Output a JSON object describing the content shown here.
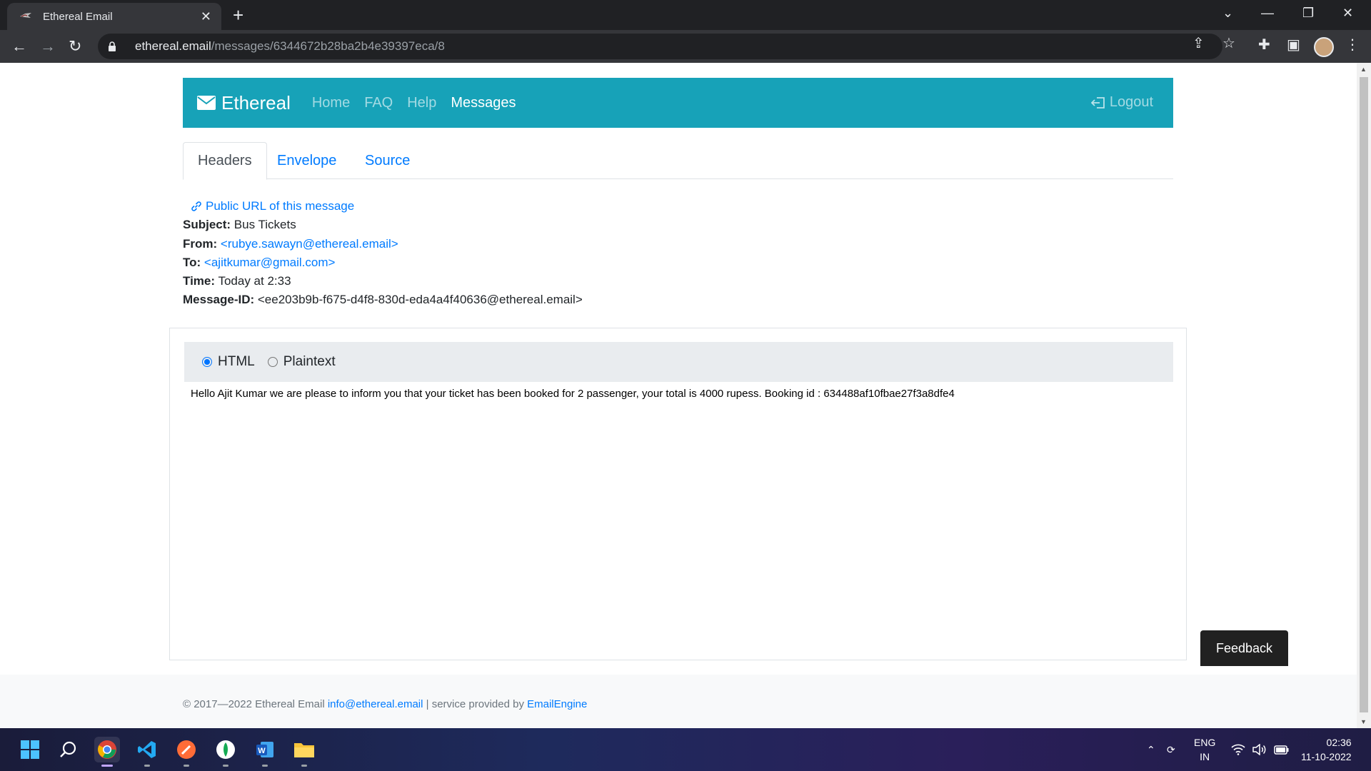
{
  "browser": {
    "tab_title": "Ethereal Email",
    "url_host": "ethereal.email",
    "url_path": "/messages/6344672b28ba2b4e39397eca/8"
  },
  "navbar": {
    "brand": "Ethereal",
    "links": [
      "Home",
      "FAQ",
      "Help",
      "Messages"
    ],
    "logout": "Logout",
    "color": "#17a2b8"
  },
  "tabs": [
    "Headers",
    "Envelope",
    "Source"
  ],
  "message": {
    "public_url_label": "Public URL of this message",
    "subject_label": "Subject:",
    "subject": "Bus Tickets",
    "from_label": "From:",
    "from": "<rubye.sawayn@ethereal.email>",
    "to_label": "To:",
    "to": "<ajitkumar@gmail.com>",
    "time_label": "Time:",
    "time": "Today at 2:33",
    "message_id_label": "Message-ID:",
    "message_id": "<ee203b9b-f675-d4f8-830d-eda4a4f40636@ethereal.email>"
  },
  "format": {
    "html_label": "HTML",
    "plaintext_label": "Plaintext",
    "selected": "HTML"
  },
  "body_text": "Hello Ajit Kumar we are please to inform you that your ticket has been booked for 2 passenger, your total is 4000 rupess. Booking id : 634488af10fbae27f3a8dfe4",
  "footer": {
    "copyright": "© 2017—2022 Ethereal Email ",
    "email": "info@ethereal.email",
    "separator": " | service provided by ",
    "provider": "EmailEngine"
  },
  "feedback_label": "Feedback",
  "system": {
    "lang_top": "ENG",
    "lang_bottom": "IN",
    "time": "02:36",
    "date": "11-10-2022"
  }
}
